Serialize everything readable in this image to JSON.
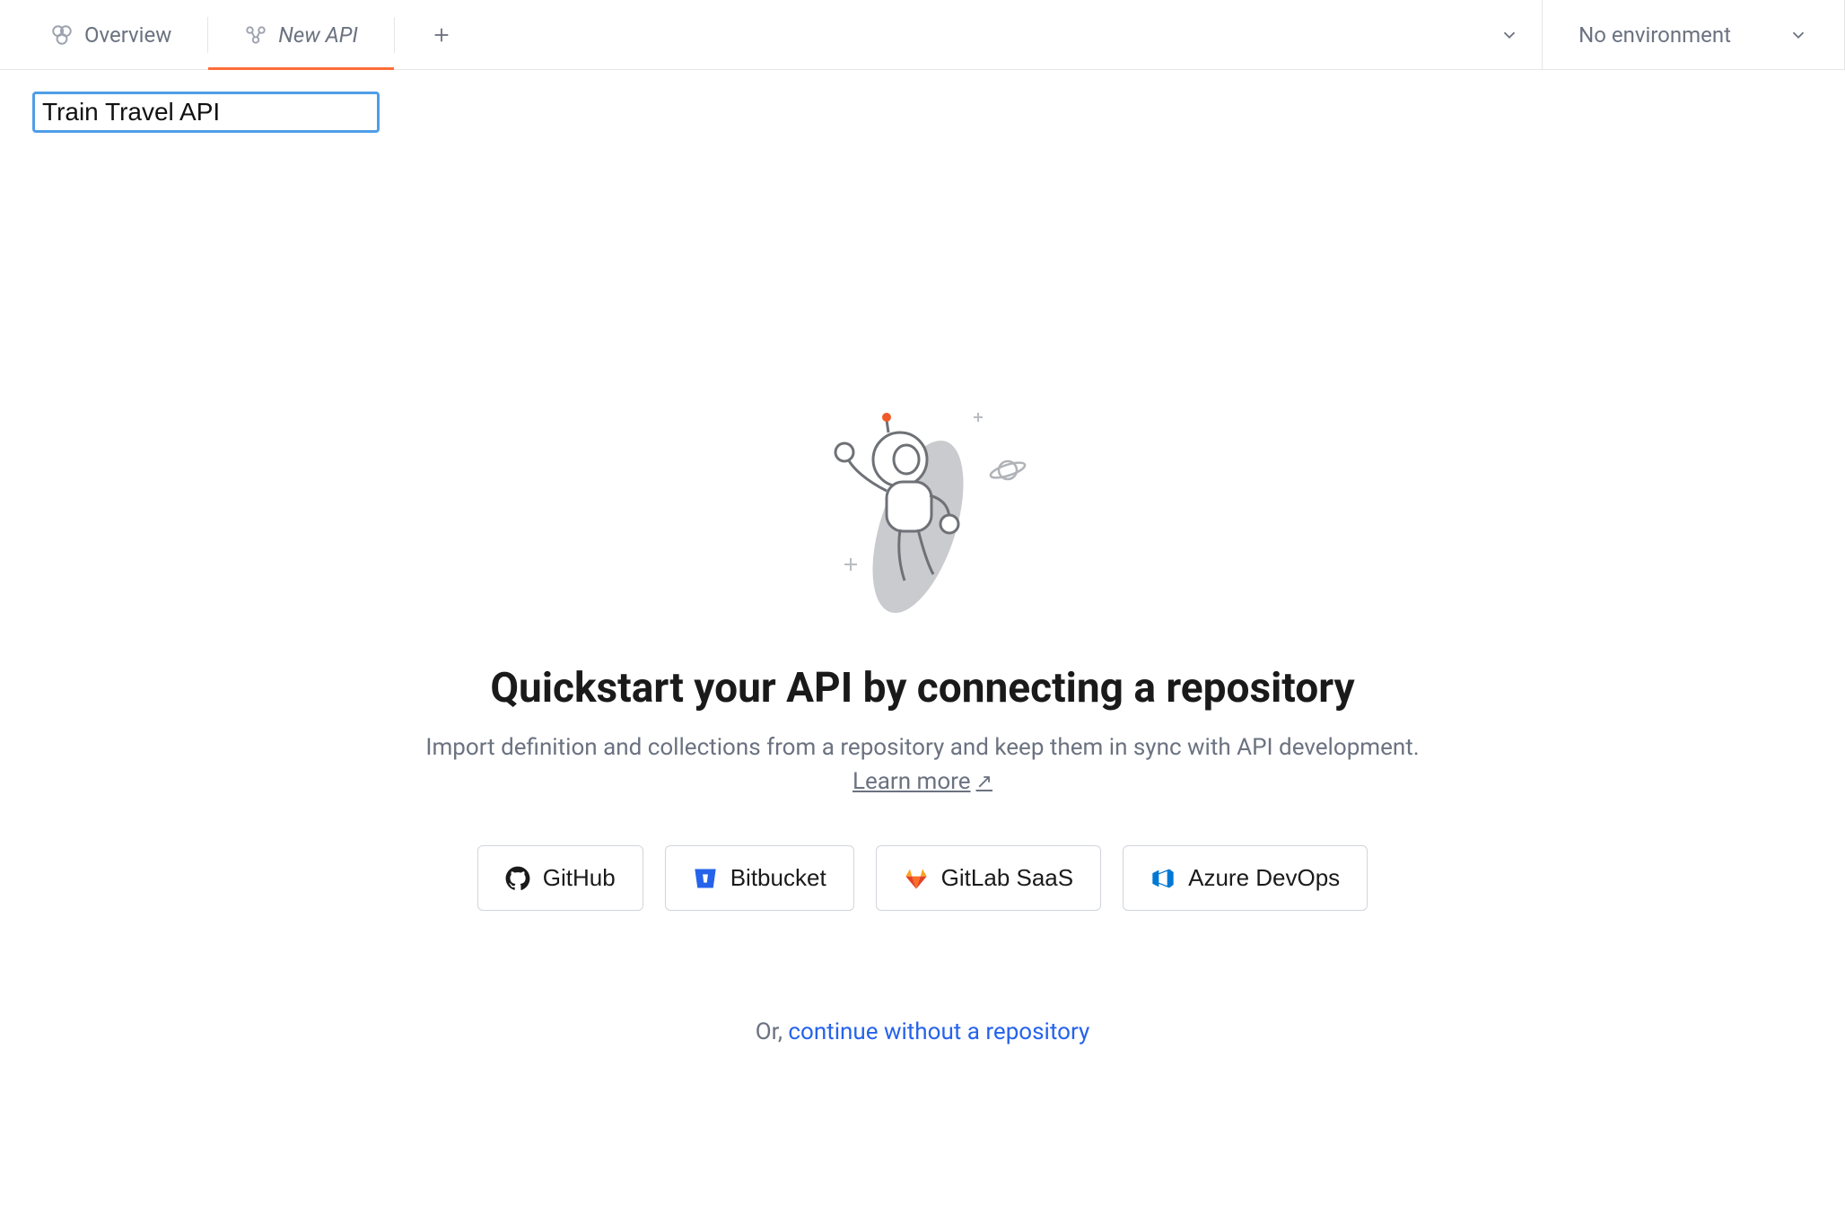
{
  "tabs": {
    "overview": {
      "label": "Overview"
    },
    "newapi": {
      "label": "New API"
    }
  },
  "environment": {
    "selected": "No environment"
  },
  "apiName": {
    "value": "Train Travel API"
  },
  "main": {
    "title": "Quickstart your API by connecting a repository",
    "subtitle": "Import definition and collections from a repository and keep them in sync with API development.",
    "learnMore": "Learn more",
    "orPrefix": "Or, ",
    "continueLink": "continue without a repository"
  },
  "repos": {
    "github": {
      "label": "GitHub"
    },
    "bitbucket": {
      "label": "Bitbucket"
    },
    "gitlab": {
      "label": "GitLab SaaS"
    },
    "azure": {
      "label": "Azure DevOps"
    }
  }
}
